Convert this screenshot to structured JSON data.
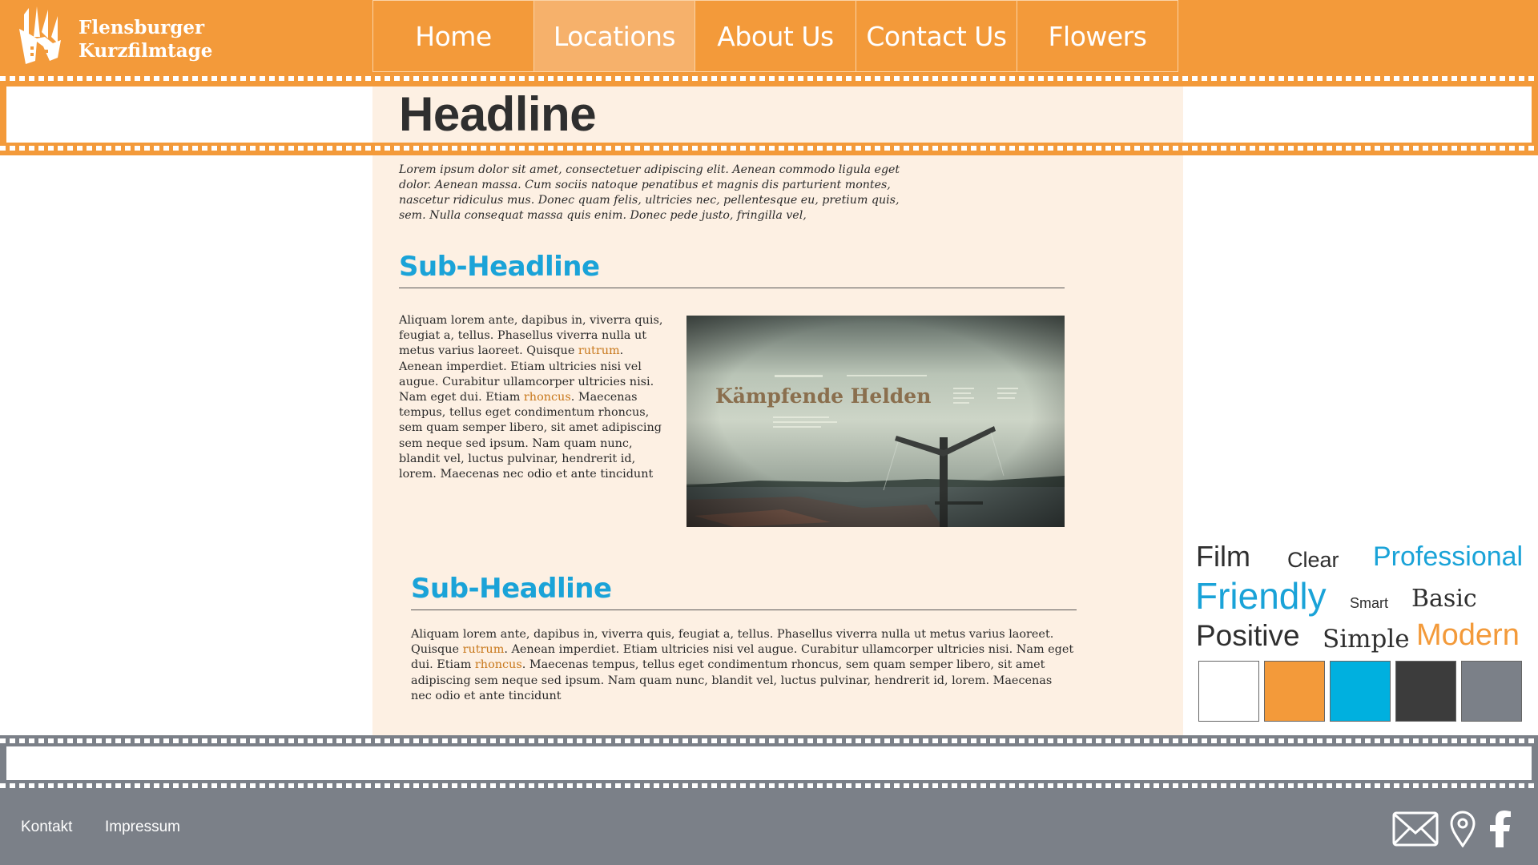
{
  "brand": {
    "line1": "Flensburger",
    "line2": "Kurzfilmtage"
  },
  "nav": {
    "items": [
      {
        "label": "Home"
      },
      {
        "label": "Locations"
      },
      {
        "label": "About Us"
      },
      {
        "label": "Contact Us"
      },
      {
        "label": "Flowers"
      }
    ],
    "active": "Locations"
  },
  "main": {
    "headline": "Headline",
    "intro": "Lorem ipsum dolor sit amet, consectetuer adipiscing elit. Aenean commodo ligula eget dolor. Aenean massa. Cum sociis natoque penatibus et magnis dis parturient montes, nascetur ridiculus mus. Donec quam felis, ultricies nec, pellentesque eu, pretium quis, sem. Nulla consequat massa quis enim. Donec pede justo, fringilla vel,",
    "section1": {
      "subheadline": "Sub-Headline",
      "text_a": "Aliquam lorem ante, dapibus in, viverra quis, feugiat a, tellus. Phasellus viverra nulla ut metus varius laoreet. Quisque ",
      "link1": "rutrum",
      "text_b": ". Aenean imperdiet. Etiam ultricies nisi vel augue. Curabitur ullamcorper ultricies nisi. Nam eget dui. Etiam ",
      "link2": "rhoncus",
      "text_c": ". Maecenas tempus, tellus eget condimentum rhoncus, sem quam semper libero, sit amet adipiscing sem neque sed ipsum. Nam quam nunc, blandit vel, luctus pulvinar, hendrerit id, lorem. Maecenas nec odio et ante tincidunt",
      "image_title": "Kämpfende Helden"
    },
    "section2": {
      "subheadline": "Sub-Headline",
      "text_a": "Aliquam lorem ante, dapibus in, viverra quis, feugiat a, tellus. Phasellus viverra nulla ut metus varius laoreet. Quisque ",
      "link1": "rutrum",
      "text_b": ". Aenean imperdiet. Etiam ultricies nisi vel augue. Curabitur ullamcorper ultricies nisi. Nam eget dui. Etiam ",
      "link2": "rhoncus",
      "text_c": ". Maecenas tempus, tellus eget condimentum rhoncus, sem quam semper libero, sit amet adipiscing sem neque sed ipsum. Nam quam nunc, blandit vel, luctus pulvinar, hendrerit id, lorem. Maecenas nec odio et ante tincidunt"
    }
  },
  "moodboard": {
    "words": [
      "Film",
      "Clear",
      "Professional",
      "Friendly",
      "Smart",
      "Basic",
      "Positive",
      "Simple",
      "Modern"
    ],
    "palette": [
      "#ffffff",
      "#f39a3a",
      "#00b0df",
      "#3c3c3c",
      "#7b8088"
    ]
  },
  "footer": {
    "links": [
      "Kontakt",
      "Impressum"
    ],
    "icons": [
      "mail-icon",
      "location-pin-icon",
      "facebook-icon"
    ]
  },
  "colors": {
    "accent": "#f39a3a",
    "headline_blue": "#1aa3d8",
    "link": "#c8781c",
    "cream": "#fdf0e3",
    "footer_gray": "#7b8088"
  }
}
